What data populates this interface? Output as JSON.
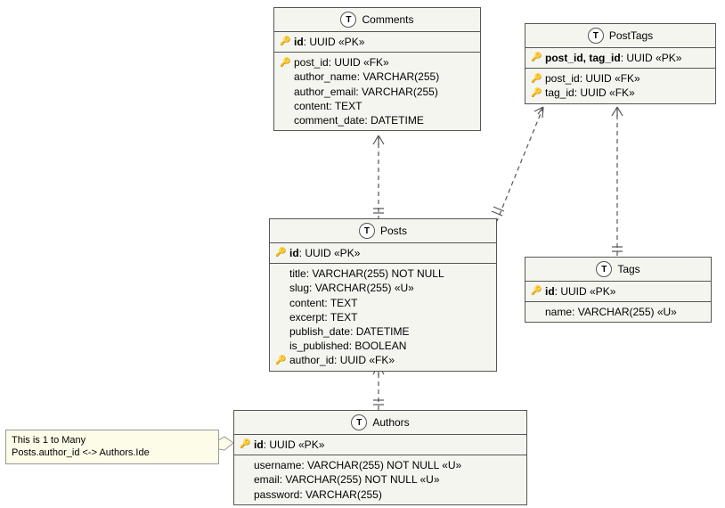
{
  "entities": {
    "comments": {
      "title": "Comments",
      "pk": [
        {
          "name": "id",
          "type": "UUID «PK»",
          "bold": true
        }
      ],
      "cols": [
        {
          "icon": "fk",
          "name": "post_id",
          "type": "UUID «FK»"
        },
        {
          "icon": "",
          "name": "author_name",
          "type": "VARCHAR(255)"
        },
        {
          "icon": "",
          "name": "author_email",
          "type": "VARCHAR(255)"
        },
        {
          "icon": "",
          "name": "content",
          "type": "TEXT"
        },
        {
          "icon": "",
          "name": "comment_date",
          "type": "DATETIME"
        }
      ]
    },
    "posttags": {
      "title": "PostTags",
      "pk": [
        {
          "name": "post_id, tag_id",
          "type": "UUID «PK»",
          "bold": true
        }
      ],
      "cols": [
        {
          "icon": "fk",
          "name": "post_id",
          "type": "UUID «FK»"
        },
        {
          "icon": "fk",
          "name": "tag_id",
          "type": "UUID «FK»"
        }
      ]
    },
    "posts": {
      "title": "Posts",
      "pk": [
        {
          "name": "id",
          "type": "UUID «PK»",
          "bold": true
        }
      ],
      "cols": [
        {
          "icon": "",
          "name": "title",
          "type": "VARCHAR(255) NOT NULL"
        },
        {
          "icon": "",
          "name": "slug",
          "type": "VARCHAR(255) «U»"
        },
        {
          "icon": "",
          "name": "content",
          "type": "TEXT"
        },
        {
          "icon": "",
          "name": "excerpt",
          "type": "TEXT"
        },
        {
          "icon": "",
          "name": "publish_date",
          "type": "DATETIME"
        },
        {
          "icon": "",
          "name": "is_published",
          "type": "BOOLEAN"
        },
        {
          "icon": "fk",
          "name": "author_id",
          "type": "UUID «FK»"
        }
      ]
    },
    "tags": {
      "title": "Tags",
      "pk": [
        {
          "name": "id",
          "type": "UUID «PK»",
          "bold": true
        }
      ],
      "cols": [
        {
          "icon": "",
          "name": "name",
          "type": "VARCHAR(255) «U»"
        }
      ]
    },
    "authors": {
      "title": "Authors",
      "pk": [
        {
          "name": "id",
          "type": "UUID «PK»",
          "bold": true
        }
      ],
      "cols": [
        {
          "icon": "",
          "name": "username",
          "type": "VARCHAR(255) NOT NULL «U»"
        },
        {
          "icon": "",
          "name": "email",
          "type": "VARCHAR(255) NOT NULL «U»"
        },
        {
          "icon": "",
          "name": "password",
          "type": "VARCHAR(255)"
        }
      ]
    }
  },
  "note": {
    "line1": "This is 1 to Many",
    "line2": "Posts.author_id <-> Authors.Ide"
  },
  "chart_data": {
    "type": "table",
    "title": "Entity-Relationship Diagram",
    "entities": [
      {
        "name": "Comments",
        "pk": [
          "id"
        ],
        "columns": [
          "post_id: UUID FK",
          "author_name: VARCHAR(255)",
          "author_email: VARCHAR(255)",
          "content: TEXT",
          "comment_date: DATETIME"
        ]
      },
      {
        "name": "PostTags",
        "pk": [
          "post_id",
          "tag_id"
        ],
        "columns": [
          "post_id: UUID FK",
          "tag_id: UUID FK"
        ]
      },
      {
        "name": "Posts",
        "pk": [
          "id"
        ],
        "columns": [
          "title: VARCHAR(255) NOT NULL",
          "slug: VARCHAR(255) U",
          "content: TEXT",
          "excerpt: TEXT",
          "publish_date: DATETIME",
          "is_published: BOOLEAN",
          "author_id: UUID FK"
        ]
      },
      {
        "name": "Tags",
        "pk": [
          "id"
        ],
        "columns": [
          "name: VARCHAR(255) U"
        ]
      },
      {
        "name": "Authors",
        "pk": [
          "id"
        ],
        "columns": [
          "username: VARCHAR(255) NOT NULL U",
          "email: VARCHAR(255) NOT NULL U",
          "password: VARCHAR(255)"
        ]
      }
    ],
    "relationships": [
      {
        "from": "Comments.post_id",
        "to": "Posts.id",
        "cardinality": "many-to-one"
      },
      {
        "from": "PostTags.post_id",
        "to": "Posts.id",
        "cardinality": "many-to-one"
      },
      {
        "from": "PostTags.tag_id",
        "to": "Tags.id",
        "cardinality": "many-to-one"
      },
      {
        "from": "Posts.author_id",
        "to": "Authors.id",
        "cardinality": "many-to-one",
        "note": "This is 1 to Many — Posts.author_id <-> Authors.Ide"
      }
    ]
  }
}
